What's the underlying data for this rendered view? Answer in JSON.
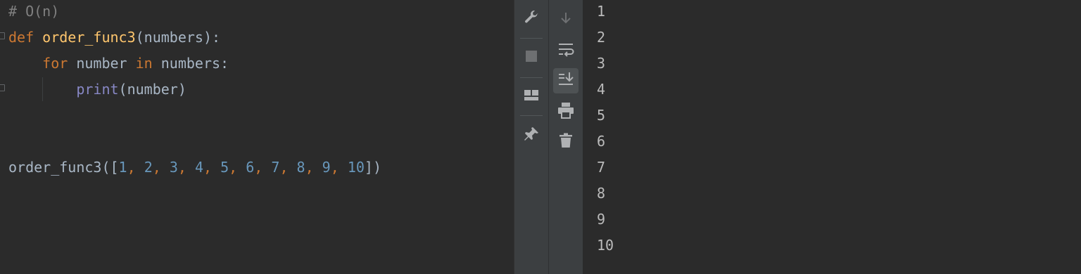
{
  "editor": {
    "lines": [
      [
        {
          "t": "# O(n)",
          "c": "comment"
        }
      ],
      [
        {
          "t": "def ",
          "c": "kw"
        },
        {
          "t": "order_func3",
          "c": "fn"
        },
        {
          "t": "(numbers):",
          "c": "plain"
        }
      ],
      [
        {
          "t": "    ",
          "c": "plain"
        },
        {
          "t": "for",
          "c": "kw"
        },
        {
          "t": " number ",
          "c": "plain"
        },
        {
          "t": "in",
          "c": "kw"
        },
        {
          "t": " numbers:",
          "c": "plain"
        }
      ],
      [
        {
          "t": "        ",
          "c": "plain"
        },
        {
          "t": "print",
          "c": "builtin"
        },
        {
          "t": "(number)",
          "c": "plain"
        }
      ],
      [],
      [],
      [
        {
          "t": "order_func3([",
          "c": "plain"
        },
        {
          "t": "1",
          "c": "num"
        },
        {
          "t": ", ",
          "c": "kw"
        },
        {
          "t": "2",
          "c": "num"
        },
        {
          "t": ", ",
          "c": "kw"
        },
        {
          "t": "3",
          "c": "num"
        },
        {
          "t": ", ",
          "c": "kw"
        },
        {
          "t": "4",
          "c": "num"
        },
        {
          "t": ", ",
          "c": "kw"
        },
        {
          "t": "5",
          "c": "num"
        },
        {
          "t": ", ",
          "c": "kw"
        },
        {
          "t": "6",
          "c": "num"
        },
        {
          "t": ", ",
          "c": "kw"
        },
        {
          "t": "7",
          "c": "num"
        },
        {
          "t": ", ",
          "c": "kw"
        },
        {
          "t": "8",
          "c": "num"
        },
        {
          "t": ", ",
          "c": "kw"
        },
        {
          "t": "9",
          "c": "num"
        },
        {
          "t": ", ",
          "c": "kw"
        },
        {
          "t": "10",
          "c": "num"
        },
        {
          "t": "])",
          "c": "plain"
        }
      ]
    ]
  },
  "run_toolbar": {
    "left_tools": [
      {
        "icon": "wrench-icon"
      },
      {
        "icon": "stop-icon"
      },
      {
        "icon": "layout-icon"
      },
      {
        "icon": "pin-icon"
      }
    ],
    "right_tools": [
      {
        "icon": "arrow-down-icon"
      },
      {
        "icon": "soft-wrap-icon"
      },
      {
        "icon": "scroll-to-end-icon",
        "active": true
      },
      {
        "icon": "print-icon"
      },
      {
        "icon": "trash-icon"
      }
    ]
  },
  "console": {
    "output": [
      "1",
      "2",
      "3",
      "4",
      "5",
      "6",
      "7",
      "8",
      "9",
      "10"
    ]
  },
  "colors": {
    "background": "#2b2b2b",
    "keyword": "#cc7832",
    "function": "#ffc66d",
    "builtin": "#8888c6",
    "number": "#6897bb",
    "comment": "#808080",
    "text": "#a9b7c6"
  }
}
